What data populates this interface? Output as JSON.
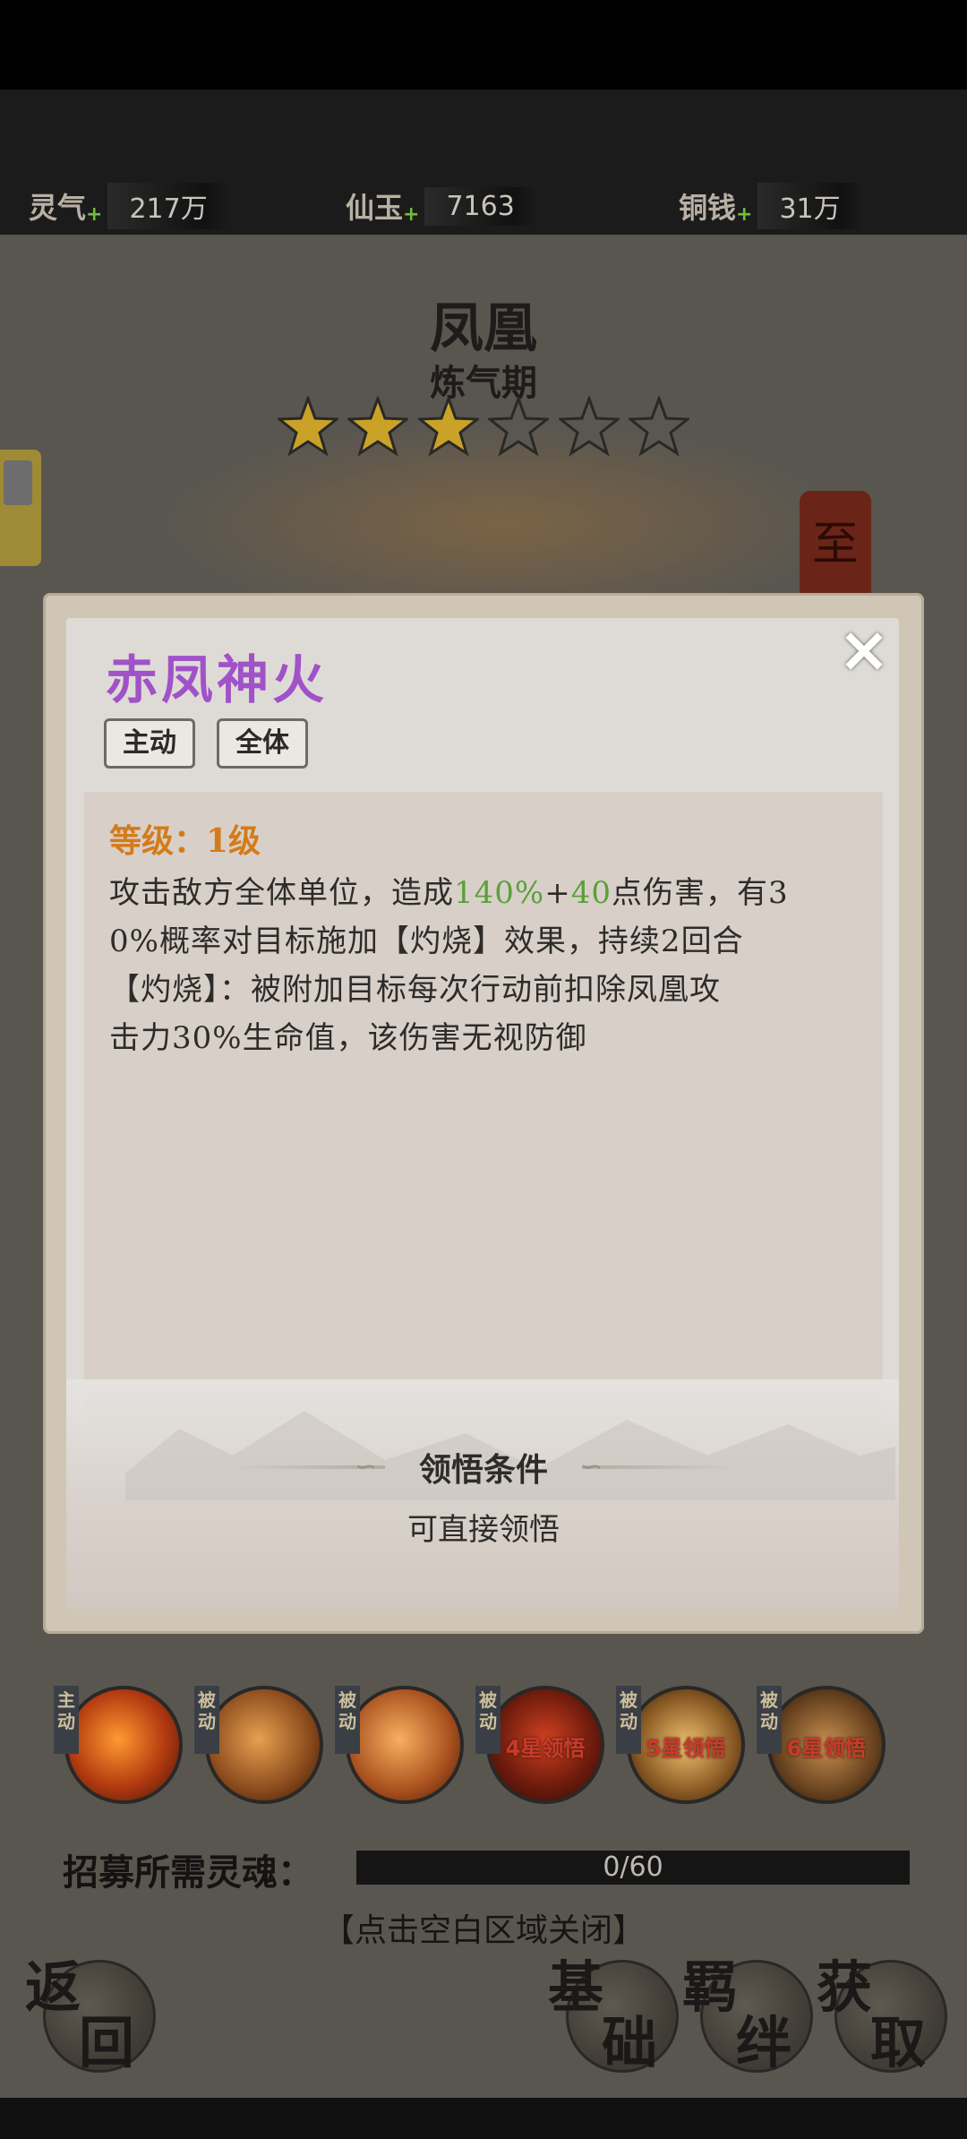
{
  "currencies": [
    {
      "name": "灵气",
      "value": "217万"
    },
    {
      "name": "仙玉",
      "value": "7163"
    },
    {
      "name": "铜钱",
      "value": "31万"
    }
  ],
  "hero": {
    "name": "凤凰",
    "realm": "炼气期",
    "stars_filled": 3,
    "stars_total": 6
  },
  "side_seal": "至",
  "popup": {
    "close_icon": "×",
    "skill_name": "赤凤神火",
    "tags": [
      "主动",
      "全体"
    ],
    "level": "等级：1级",
    "desc": {
      "l1_a": "攻击敌方全体单位，造成",
      "l1_green1": "140%",
      "l1_plus": "+",
      "l1_green2": "40",
      "l1_b": "点伤害，有3",
      "l2": "0%概率对目标施加【灼烧】效果，持续2回合",
      "l3": "【灼烧】：被附加目标每次行动前扣除凤凰攻",
      "l4": "击力30%生命值，该伤害无视防御"
    },
    "condition_title": "领悟条件",
    "condition_value": "可直接领悟"
  },
  "skills": [
    {
      "tag": "主动",
      "lock": ""
    },
    {
      "tag": "被动",
      "lock": ""
    },
    {
      "tag": "被动",
      "lock": ""
    },
    {
      "tag": "被动",
      "lock": "4星领悟"
    },
    {
      "tag": "被动",
      "lock": "5星领悟"
    },
    {
      "tag": "被动",
      "lock": "6星领悟"
    }
  ],
  "recruit": {
    "label": "招募所需灵魂：",
    "progress": "0/60",
    "fraction": 0.0
  },
  "close_hint": "【点击空白区域关闭】",
  "nav": {
    "back": [
      "返",
      "回"
    ],
    "basic": [
      "基",
      "础"
    ],
    "bond": [
      "羁",
      "绊"
    ],
    "obtain": [
      "获",
      "取"
    ]
  },
  "colors": {
    "skill_name": "#a052c8",
    "level": "#d47b1a",
    "highlight": "#5aa03a",
    "star_on": "#c9a227",
    "star_off": "#5a5753"
  }
}
